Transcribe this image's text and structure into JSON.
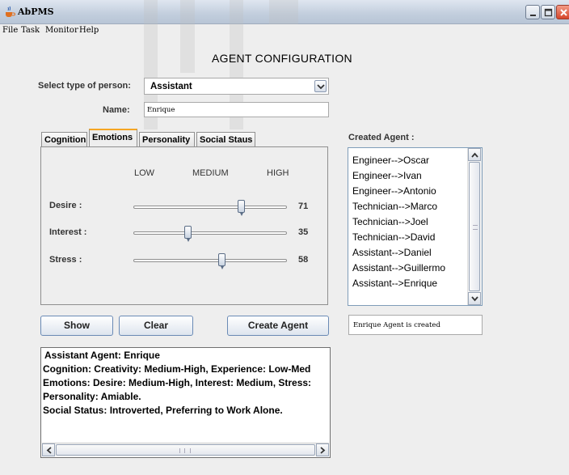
{
  "window": {
    "title": "AbPMS"
  },
  "menu": [
    "File",
    "Task",
    "Monitor",
    "Help"
  ],
  "heading": "AGENT CONFIGURATION",
  "form": {
    "person_type_label": "Select type of person:",
    "person_type_value": "Assistant",
    "name_label": "Name:",
    "name_value": "Enrique"
  },
  "tabs": [
    {
      "label": "Cognition",
      "active": false
    },
    {
      "label": "Emotions",
      "active": true
    },
    {
      "label": "Personality",
      "active": false
    },
    {
      "label": "Social Staus",
      "active": false
    }
  ],
  "levels": [
    "LOW",
    "MEDIUM",
    "HIGH"
  ],
  "sliders": [
    {
      "label": "Desire :",
      "value": 71
    },
    {
      "label": "Interest :",
      "value": 35
    },
    {
      "label": "Stress :",
      "value": 58
    }
  ],
  "buttons": {
    "show": "Show",
    "clear": "Clear",
    "create": "Create Agent"
  },
  "output_lines": [
    "Assistant Agent:  Enrique",
    "Cognition:  Creativity: Medium-High,  Experience: Low-Med",
    "Emotions:  Desire: Medium-High,  Interest: Medium,  Stress:",
    "Personality:  Amiable.",
    "Social Status:  Introverted,  Preferring to Work Alone."
  ],
  "created_agents": {
    "label": "Created Agent :",
    "items": [
      "Engineer-->Oscar",
      "Engineer-->Ivan",
      "Engineer-->Antonio",
      "Technician-->Marco",
      "Technician-->Joel",
      "Technician-->David",
      "Assistant-->Daniel",
      "Assistant-->Guillermo",
      "Assistant-->Enrique"
    ]
  },
  "status": "Enrique Agent is created",
  "colors": {
    "active_tab_accent": "#f5a623",
    "button_border": "#6a8ab5",
    "close_button": "#d6452a"
  }
}
